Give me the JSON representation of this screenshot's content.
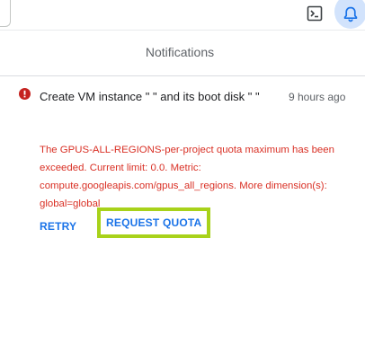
{
  "topbar": {
    "terminal_icon": "terminal-icon",
    "bell_icon": "bell-icon"
  },
  "panel": {
    "title": "Notifications"
  },
  "notification": {
    "status_icon": "error-icon",
    "title": "Create VM instance \"             \" and its boot disk \"            \"",
    "time": "9 hours ago",
    "message": "The GPUS-ALL-REGIONS-per-project quota maximum has been exceeded. Current limit: 0.0. Metric: compute.googleapis.com/gpus_all_regions. More dimension(s): global=global",
    "actions": {
      "retry_label": "RETRY",
      "request_quota_label": "REQUEST QUOTA"
    }
  },
  "colors": {
    "accent": "#1a73e8",
    "error": "#d93025",
    "highlight": "#a8d21a",
    "bell_bg": "#d2e3fc"
  }
}
